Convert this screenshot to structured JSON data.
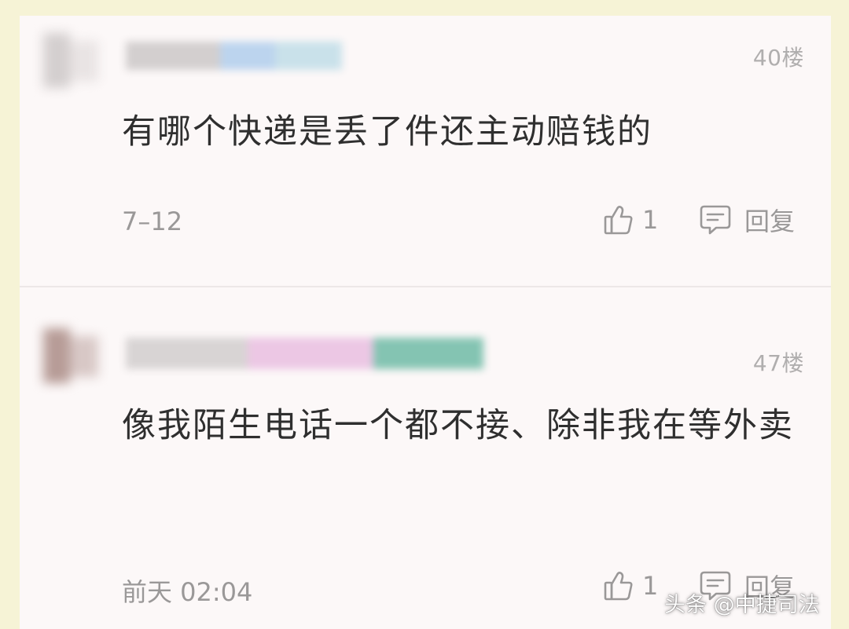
{
  "comments": [
    {
      "floor": "40楼",
      "text": "有哪个快递是丢了件还主动赔钱的",
      "date": "7–12",
      "likes": "1",
      "reply_label": "回复"
    },
    {
      "floor": "47楼",
      "text": "像我陌生电话一个都不接、除非我在等外卖",
      "date": "前天 02:04",
      "likes": "1",
      "reply_label": "回复"
    }
  ],
  "watermark": "头条 @中捷司法",
  "colors": {
    "outer_background": "#f6f3d6",
    "panel_background": "#fcf8f8",
    "text": "#2f2f2f",
    "meta_text": "#9a9898"
  },
  "icons": {
    "like": "thumbs-up-icon",
    "reply": "comment-bubble-icon"
  }
}
